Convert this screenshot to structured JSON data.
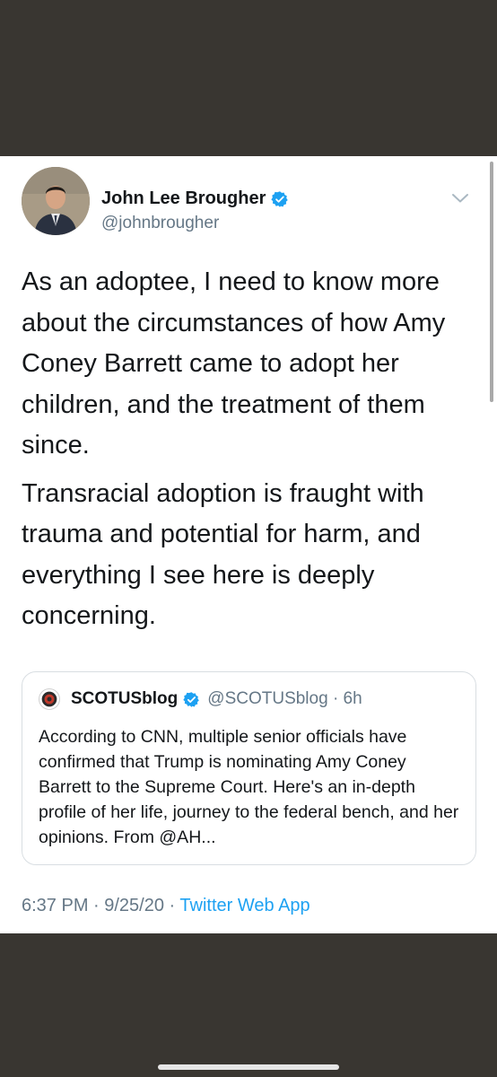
{
  "tweet": {
    "author": {
      "name": "John Lee Brougher",
      "handle": "@johnbrougher",
      "verified": true
    },
    "paragraphs": [
      "As an adoptee, I need to know more about the circumstances of how Amy Coney Barrett came to adopt her children, and the treatment of them since.",
      "Transracial adoption is fraught with trauma and potential for harm, and everything I see here is deeply concerning."
    ],
    "quoted": {
      "name": "SCOTUSblog",
      "handle_time": "@SCOTUSblog · 6h",
      "verified": true,
      "text": "According to CNN, multiple senior officials have confirmed that Trump is nominating Amy Coney Barrett to the Supreme Court. Here's an in-depth profile of her life, journey to the federal bench, and her opinions. From @AH..."
    },
    "timestamp": "6:37 PM · 9/25/20 · ",
    "source_app": "Twitter Web App"
  },
  "colors": {
    "accent": "#1da1f2",
    "secondary_text": "#657786",
    "background_dark": "#393631"
  },
  "icons": {
    "verified": "verified-badge-icon",
    "more": "chevron-down-icon"
  }
}
